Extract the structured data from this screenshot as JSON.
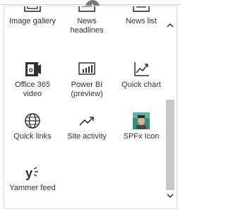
{
  "panel": {
    "handle_label": "I",
    "tiles": [
      {
        "label": "Image gallery",
        "icon": "image-gallery-icon"
      },
      {
        "label": "News\nheadlines",
        "icon": "news-headlines-icon"
      },
      {
        "label": "News list",
        "icon": "news-list-icon"
      },
      {
        "label": "Office 365\nvideo",
        "icon": "office-365-video-icon"
      },
      {
        "label": "Power BI\n(preview)",
        "icon": "power-bi-icon"
      },
      {
        "label": "Quick chart",
        "icon": "quick-chart-icon"
      },
      {
        "label": "Quick links",
        "icon": "globe-icon"
      },
      {
        "label": "Site activity",
        "icon": "activity-icon"
      },
      {
        "label": "SPFx Icon",
        "icon": "spfx-icon-image"
      },
      {
        "label": "Yammer feed",
        "icon": "yammer-icon"
      }
    ]
  },
  "scrollbar": {
    "up_icon": "chevron-up-icon",
    "down_icon": "chevron-down-icon"
  },
  "colors": {
    "text": "#323130",
    "thumb": "#c8c8c8",
    "border": "#e1dfdd",
    "office_orange": "#d83b01"
  }
}
